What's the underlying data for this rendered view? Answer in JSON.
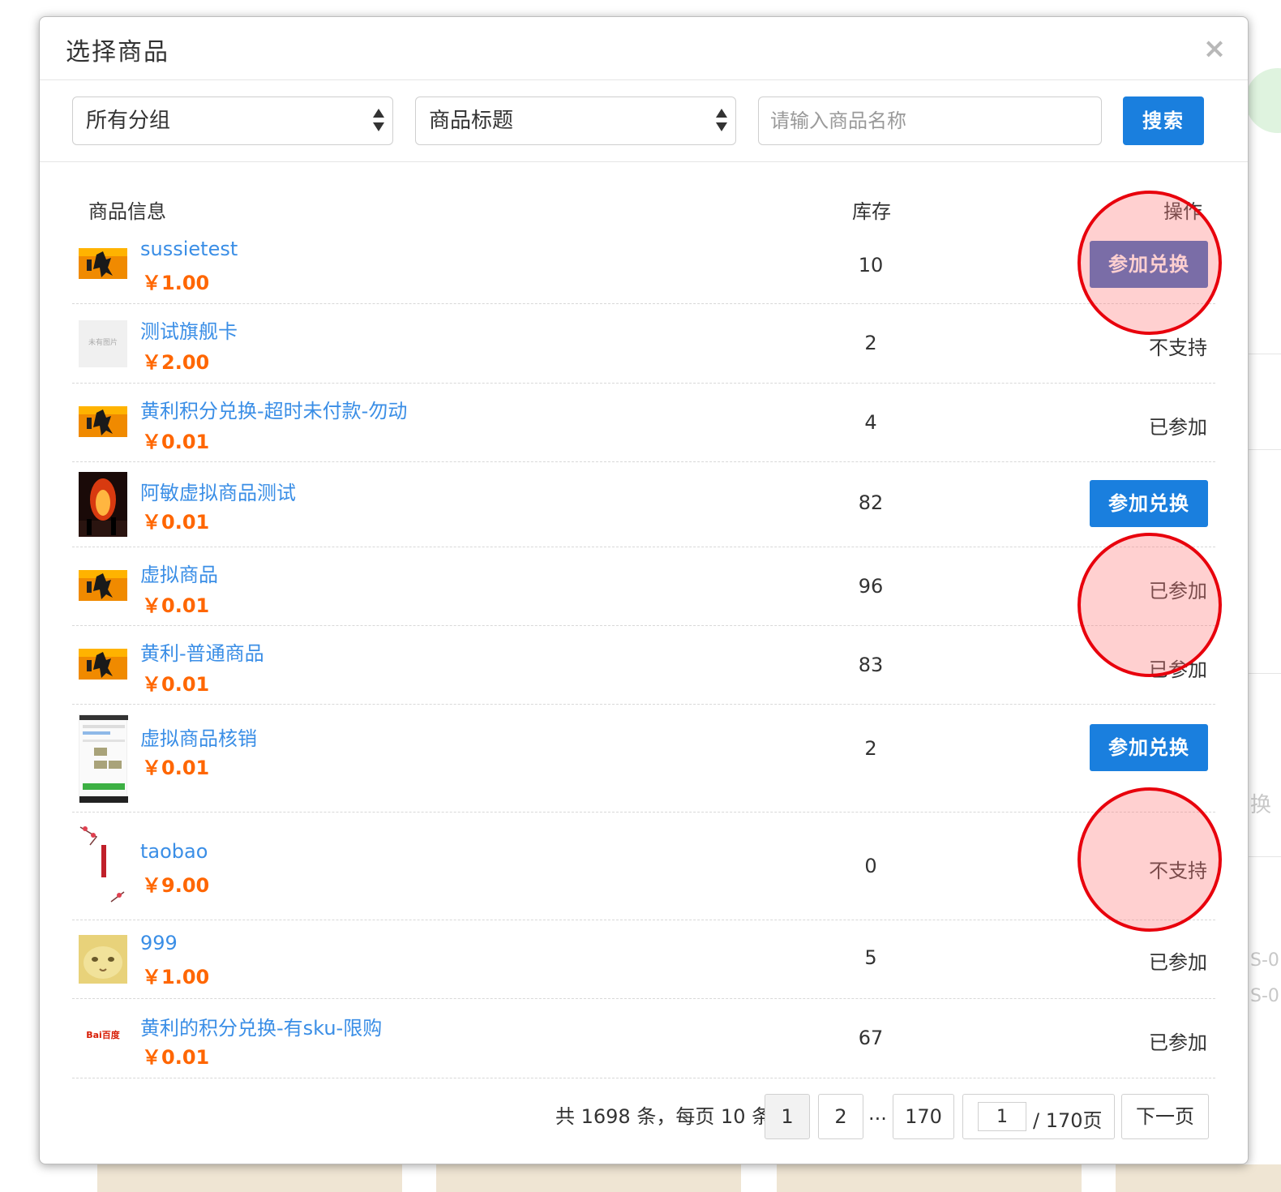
{
  "dialog": {
    "title": "选择商品",
    "close_symbol": "×"
  },
  "filters": {
    "group_select": "所有分组",
    "field_select": "商品标题",
    "search_placeholder": "请输入商品名称",
    "search_button": "搜索"
  },
  "table": {
    "headers": {
      "info": "商品信息",
      "stock": "库存",
      "action": "操作"
    },
    "rows": [
      {
        "title": "sussietest",
        "price": "￥1.00",
        "stock": "10",
        "action": "参加兑换",
        "action_type": "button",
        "thumb": "fire-poster"
      },
      {
        "title": "测试旗舰卡",
        "price": "￥2.00",
        "stock": "2",
        "action": "不支持",
        "action_type": "text",
        "thumb": "no-image"
      },
      {
        "title": "黄利积分兑换-超时未付款-勿动",
        "price": "￥0.01",
        "stock": "4",
        "action": "已参加",
        "action_type": "text",
        "thumb": "fire-poster"
      },
      {
        "title": "阿敏虚拟商品测试",
        "price": "￥0.01",
        "stock": "82",
        "action": "参加兑换",
        "action_type": "button",
        "thumb": "bonfire-photo"
      },
      {
        "title": "虚拟商品",
        "price": "￥0.01",
        "stock": "96",
        "action": "已参加",
        "action_type": "text",
        "thumb": "fire-poster"
      },
      {
        "title": "黄利-普通商品",
        "price": "￥0.01",
        "stock": "83",
        "action": "已参加",
        "action_type": "text",
        "thumb": "fire-poster"
      },
      {
        "title": "虚拟商品核销",
        "price": "￥0.01",
        "stock": "2",
        "action": "参加兑换",
        "action_type": "button",
        "thumb": "phone-screenshot"
      },
      {
        "title": "taobao",
        "price": "￥9.00",
        "stock": "0",
        "action": "不支持",
        "action_type": "text",
        "thumb": "plum-blossom"
      },
      {
        "title": "999",
        "price": "￥1.00",
        "stock": "5",
        "action": "已参加",
        "action_type": "text",
        "thumb": "cat-photo"
      },
      {
        "title": "黄利的积分兑换-有sku-限购",
        "price": "￥0.01",
        "stock": "67",
        "action": "已参加",
        "action_type": "text",
        "thumb": "baidu-logo"
      }
    ]
  },
  "thumb_texts": {
    "no_image": "未有图片",
    "baidu": "Bai百度"
  },
  "pagination": {
    "summary": "共 1698 条，每页 10 条",
    "pages": [
      "1",
      "2",
      "170"
    ],
    "ellipsis": "...",
    "current_input": "1",
    "total_pages": "/ 170页",
    "next": "下一页"
  },
  "background_fragments": [
    "换",
    "S-0",
    "S-0"
  ],
  "colors": {
    "primary": "#1a7fde",
    "link": "#3a8ee6",
    "price": "#ff6600",
    "highlight": "#e8000c"
  }
}
